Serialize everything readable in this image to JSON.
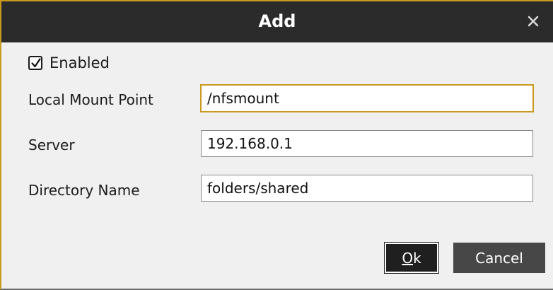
{
  "dialog": {
    "title": "Add",
    "close_icon": "close-icon"
  },
  "enabled": {
    "label": "Enabled",
    "checked": true
  },
  "fields": {
    "local_mount_point": {
      "label": "Local Mount Point",
      "value": "/nfsmount"
    },
    "server": {
      "label": "Server",
      "value": "192.168.0.1"
    },
    "directory_name": {
      "label": "Directory Name",
      "value": "folders/shared"
    }
  },
  "buttons": {
    "ok_mnemonic": "O",
    "ok_rest": "k",
    "cancel": "Cancel"
  },
  "colors": {
    "accent": "#c99a1e",
    "titlebar": "#2b2b2b",
    "button": "#474747"
  }
}
